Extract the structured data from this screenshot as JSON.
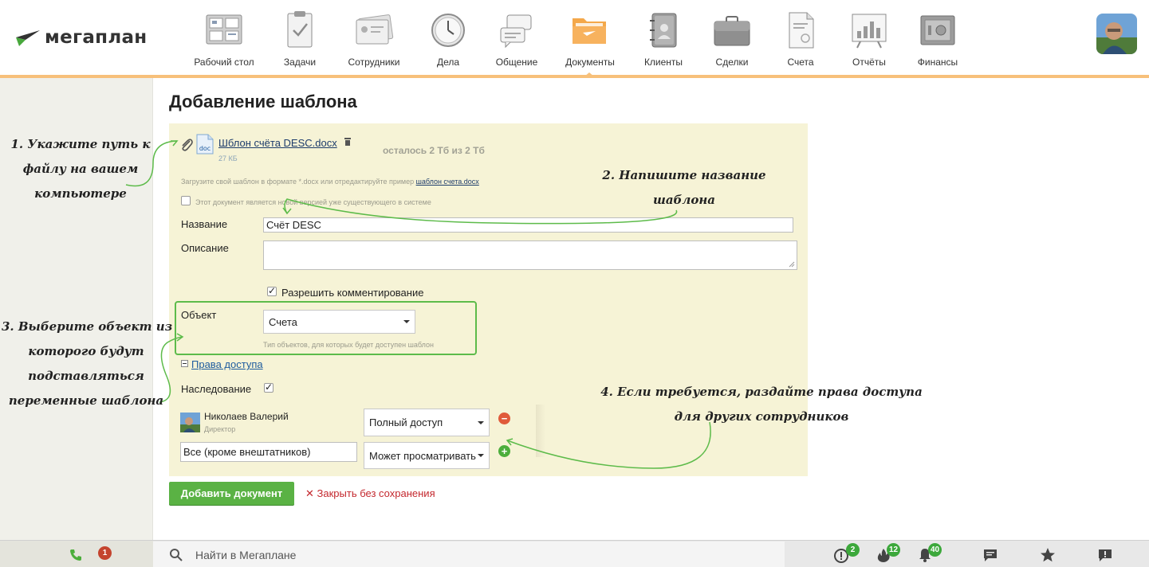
{
  "app": {
    "logo_text": "мегаплан"
  },
  "nav": {
    "items": [
      {
        "label": "Рабочий стол",
        "icon": "desktop-icon"
      },
      {
        "label": "Задачи",
        "icon": "tasks-icon"
      },
      {
        "label": "Сотрудники",
        "icon": "employees-icon"
      },
      {
        "label": "Дела",
        "icon": "clock-icon"
      },
      {
        "label": "Общение",
        "icon": "chat-icon"
      },
      {
        "label": "Документы",
        "icon": "folder-icon",
        "active": true
      },
      {
        "label": "Клиенты",
        "icon": "address-book-icon"
      },
      {
        "label": "Сделки",
        "icon": "briefcase-icon"
      },
      {
        "label": "Счета",
        "icon": "invoice-icon"
      },
      {
        "label": "Отчёты",
        "icon": "chart-board-icon"
      },
      {
        "label": "Финансы",
        "icon": "safe-icon"
      }
    ]
  },
  "page": {
    "title": "Добавление шаблона"
  },
  "file": {
    "name": "Шблон счёта DESC.docx",
    "size": "27 КБ",
    "type_label": "doc",
    "storage_left": "осталось 2 Тб из 2 Тб"
  },
  "upload": {
    "hint": "Загрузите свой шаблон в формате *.docx или отредактируйте пример ",
    "example_link": "шаблон счета.docx"
  },
  "form": {
    "new_version_label": "Этот документ является новой версией уже существующего в системе",
    "name_label": "Название",
    "name_value": "Счёт DESC",
    "description_label": "Описание",
    "description_value": "",
    "allow_comments_label": "Разрешить комментирование",
    "allow_comments_checked": true,
    "object_label": "Объект",
    "object_value": "Счета",
    "object_hint": "Тип объектов, для которых будет доступен шаблон",
    "access_link": "Права доступа",
    "inheritance_label": "Наследование",
    "inheritance_checked": true
  },
  "access": {
    "user_name": "Николаев Валерий",
    "user_role": "Директор",
    "user_access": "Полный доступ",
    "group_value": "Все (кроме внештатников)",
    "group_access": "Может просматривать"
  },
  "actions": {
    "submit_label": "Добавить документ",
    "close_label": "Закрыть без сохранения",
    "close_mark": "✕"
  },
  "annotations": {
    "step1": [
      "1. Укажите путь к",
      "файлу на вашем",
      "компьютере"
    ],
    "step2": [
      "2. Напишите название",
      "шаблона"
    ],
    "step3": [
      "3. Выберите объект из",
      "которого будут",
      "подставляться",
      "переменные шаблона"
    ],
    "step4": [
      "4. Если требуется, раздайте права доступа",
      "для других сотрудников"
    ]
  },
  "bottom": {
    "call_badge": "1",
    "search_placeholder": "Найти в Мегаплане",
    "alerts_badge": "2",
    "hot_badge": "12",
    "notifications_badge": "40"
  },
  "colors": {
    "accent_green": "#5ab244",
    "header_accent": "#f7c07a",
    "panel_bg": "#f6f3d6",
    "annotation_green": "#5dbb4a",
    "close_red": "#c4282e"
  }
}
